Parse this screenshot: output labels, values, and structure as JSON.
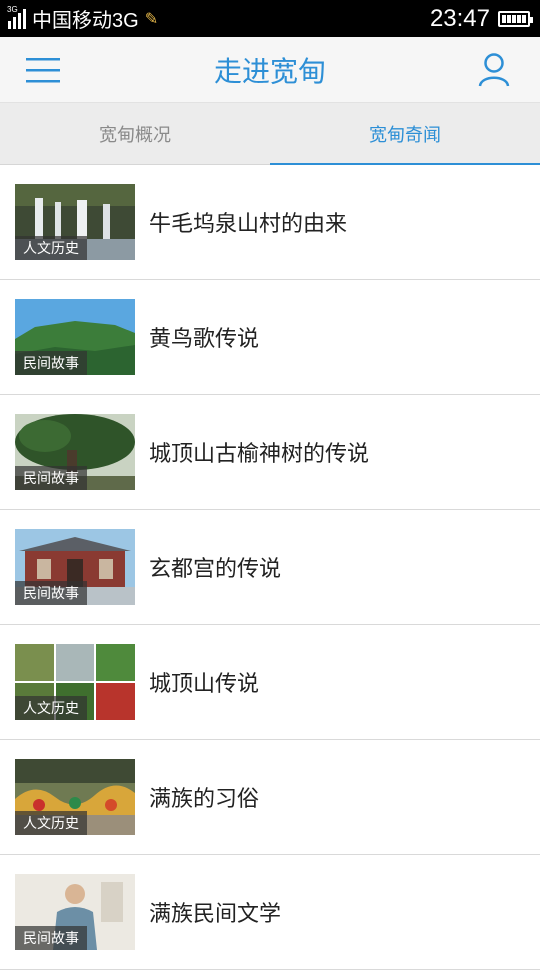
{
  "status": {
    "network_tag": "3G",
    "carrier": "中国移动3G",
    "time": "23:47"
  },
  "header": {
    "title": "走进宽甸",
    "menu_icon": "menu-icon",
    "user_icon": "user-icon"
  },
  "tabs": [
    {
      "label": "宽甸概况"
    },
    {
      "label": "宽甸奇闻"
    }
  ],
  "items": [
    {
      "title": "牛毛坞泉山村的由来",
      "category": "人文历史"
    },
    {
      "title": "黄鸟歌传说",
      "category": "民间故事"
    },
    {
      "title": "城顶山古榆神树的传说",
      "category": "民间故事"
    },
    {
      "title": "玄都宫的传说",
      "category": "民间故事"
    },
    {
      "title": "城顶山传说",
      "category": "人文历史"
    },
    {
      "title": "满族的习俗",
      "category": "人文历史"
    },
    {
      "title": "满族民间文学",
      "category": "民间故事"
    }
  ]
}
